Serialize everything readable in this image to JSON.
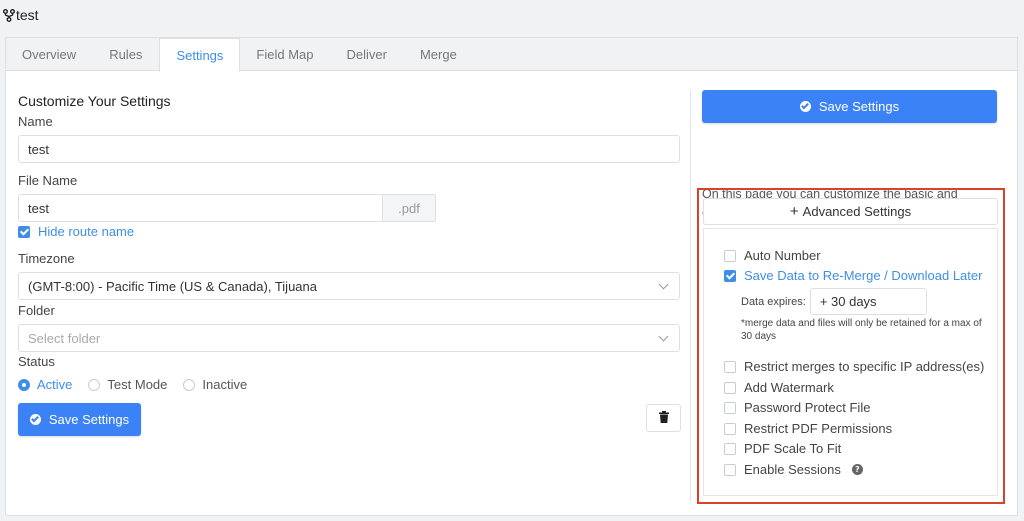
{
  "app": {
    "title": "test"
  },
  "tabs": [
    "Overview",
    "Rules",
    "Settings",
    "Field Map",
    "Deliver",
    "Merge"
  ],
  "form": {
    "heading": "Customize Your Settings",
    "name_label": "Name",
    "name_value": "test",
    "file_name_label": "File Name",
    "file_name_value": "test",
    "file_ext": ".pdf",
    "hide_route_name": "Hide route name",
    "timezone_label": "Timezone",
    "timezone_value": "(GMT-8:00) - Pacific Time (US & Canada), Tijuana",
    "folder_label": "Folder",
    "folder_placeholder": "Select folder",
    "status_label": "Status",
    "status_options": [
      "Active",
      "Test Mode",
      "Inactive"
    ],
    "save_label": "Save Settings"
  },
  "sidebar": {
    "save_label": "Save Settings",
    "description": "On this page you can customize the basic and advanced settings of your Data Route.",
    "advanced_label": "Advanced Settings",
    "options": {
      "auto_number": "Auto Number",
      "save_data": "Save Data to Re-Merge / Download Later",
      "restrict_ip": "Restrict merges to specific IP address(es)",
      "watermark": "Add Watermark",
      "password": "Password Protect File",
      "restrict_pdf": "Restrict PDF Permissions",
      "scale": "PDF Scale To Fit",
      "sessions": "Enable Sessions"
    },
    "expires_label": "Data expires:",
    "expires_value": "+ 30 days",
    "note": "*merge data and files will only be retained for a max of 30 days",
    "help_glyph": "?"
  },
  "colors": {
    "accent": "#3b82f6",
    "highlight_border": "#d9412c"
  }
}
